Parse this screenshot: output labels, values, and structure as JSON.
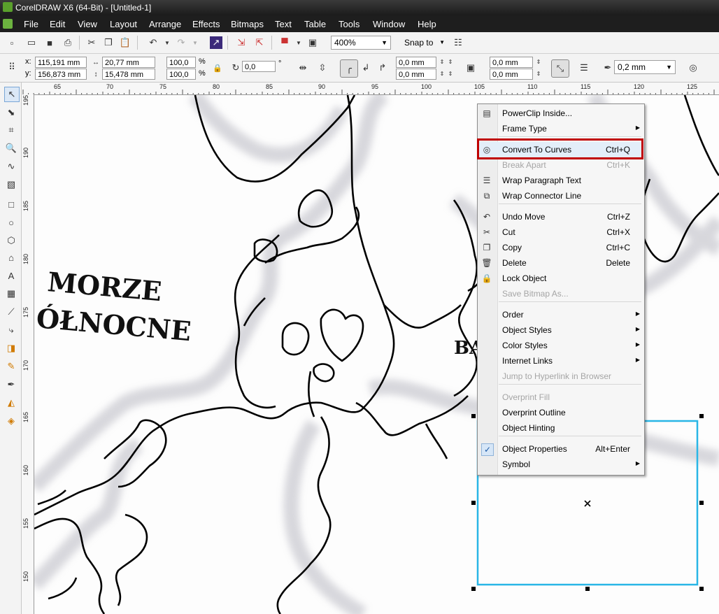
{
  "window": {
    "title": "CorelDRAW X6 (64-Bit) - [Untitled-1]"
  },
  "menu": [
    "File",
    "Edit",
    "View",
    "Layout",
    "Arrange",
    "Effects",
    "Bitmaps",
    "Text",
    "Table",
    "Tools",
    "Window",
    "Help"
  ],
  "toolbar1": {
    "zoom": "400%",
    "snap": "Snap to"
  },
  "propbar": {
    "x_label": "x:",
    "x": "115,191 mm",
    "y_label": "y:",
    "y": "156,873 mm",
    "width": "20,77 mm",
    "height": "15,478 mm",
    "scale_x": "100,0",
    "scale_y": "100,0",
    "pct1": "%",
    "pct2": "%",
    "angle": "0,0",
    "deg": "°",
    "corner1": "0,0 mm",
    "corner2": "0,0 mm",
    "corner3": "0,0 mm",
    "corner4": "0,0 mm",
    "outline": "0,2 mm"
  },
  "hruler": [
    "65",
    "70",
    "75",
    "80",
    "85",
    "90",
    "95",
    "100",
    "105",
    "110",
    "115",
    "120",
    "125"
  ],
  "vruler": [
    "195",
    "190",
    "185",
    "180",
    "175",
    "170",
    "165",
    "160",
    "155",
    "150"
  ],
  "map_text": {
    "line1": "MORZE",
    "line2": "ÓŁNOCNE",
    "partial": "BA"
  },
  "context_menu": {
    "items": [
      {
        "label": "PowerClip Inside...",
        "shortcut": "",
        "submenu": false,
        "enabled": true,
        "icon": "powerclip-icon"
      },
      {
        "label": "Frame Type",
        "shortcut": "",
        "submenu": true,
        "enabled": true,
        "icon": ""
      },
      {
        "label": "Convert To Curves",
        "shortcut": "Ctrl+Q",
        "submenu": false,
        "enabled": true,
        "icon": "convert-curves-icon"
      },
      {
        "label": "Break Apart",
        "shortcut": "Ctrl+K",
        "submenu": false,
        "enabled": false,
        "icon": ""
      },
      {
        "label": "Wrap Paragraph Text",
        "shortcut": "",
        "submenu": false,
        "enabled": true,
        "icon": "wrap-text-icon"
      },
      {
        "label": "Wrap Connector Line",
        "shortcut": "",
        "submenu": false,
        "enabled": true,
        "icon": "wrap-connector-icon"
      },
      {
        "label": "Undo Move",
        "shortcut": "Ctrl+Z",
        "submenu": false,
        "enabled": true,
        "icon": "undo-icon"
      },
      {
        "label": "Cut",
        "shortcut": "Ctrl+X",
        "submenu": false,
        "enabled": true,
        "icon": "scissors-icon"
      },
      {
        "label": "Copy",
        "shortcut": "Ctrl+C",
        "submenu": false,
        "enabled": true,
        "icon": "copy-icon"
      },
      {
        "label": "Delete",
        "shortcut": "Delete",
        "submenu": false,
        "enabled": true,
        "icon": "trash-icon"
      },
      {
        "label": "Lock Object",
        "shortcut": "",
        "submenu": false,
        "enabled": true,
        "icon": "lock-icon"
      },
      {
        "label": "Save Bitmap As...",
        "shortcut": "",
        "submenu": false,
        "enabled": false,
        "icon": ""
      },
      {
        "label": "Order",
        "shortcut": "",
        "submenu": true,
        "enabled": true,
        "icon": ""
      },
      {
        "label": "Object Styles",
        "shortcut": "",
        "submenu": true,
        "enabled": true,
        "icon": ""
      },
      {
        "label": "Color Styles",
        "shortcut": "",
        "submenu": true,
        "enabled": true,
        "icon": ""
      },
      {
        "label": "Internet Links",
        "shortcut": "",
        "submenu": true,
        "enabled": true,
        "icon": ""
      },
      {
        "label": "Jump to Hyperlink in Browser",
        "shortcut": "",
        "submenu": false,
        "enabled": false,
        "icon": ""
      },
      {
        "label": "Overprint Fill",
        "shortcut": "",
        "submenu": false,
        "enabled": false,
        "icon": ""
      },
      {
        "label": "Overprint Outline",
        "shortcut": "",
        "submenu": false,
        "enabled": true,
        "icon": ""
      },
      {
        "label": "Object Hinting",
        "shortcut": "",
        "submenu": false,
        "enabled": true,
        "icon": ""
      },
      {
        "label": "Object Properties",
        "shortcut": "Alt+Enter",
        "submenu": false,
        "enabled": true,
        "icon": "check-icon"
      },
      {
        "label": "Symbol",
        "shortcut": "",
        "submenu": true,
        "enabled": true,
        "icon": ""
      }
    ]
  },
  "colors": {
    "highlight_border": "#c00000",
    "selection": "#29b6e6"
  }
}
